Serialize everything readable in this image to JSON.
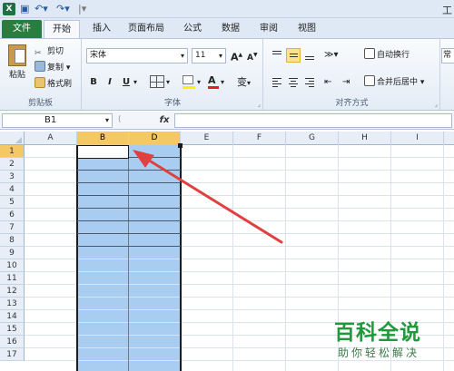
{
  "window": {
    "title": "工",
    "app_icon": "X"
  },
  "quick_access": {
    "save_icon": "save-icon",
    "undo_icon": "undo-icon",
    "redo_icon": "redo-icon"
  },
  "tabs": [
    {
      "label": "文件"
    },
    {
      "label": "开始"
    },
    {
      "label": "插入"
    },
    {
      "label": "页面布局"
    },
    {
      "label": "公式"
    },
    {
      "label": "数据"
    },
    {
      "label": "审阅"
    },
    {
      "label": "视图"
    }
  ],
  "ribbon": {
    "clipboard": {
      "label": "剪贴板",
      "paste": "粘贴",
      "cut": "剪切",
      "copy": "复制",
      "format_painter": "格式刷"
    },
    "font": {
      "label": "字体",
      "font_name": "宋体",
      "font_size": "11",
      "bold": "B",
      "italic": "I",
      "underline": "U",
      "phonetic": "变"
    },
    "alignment": {
      "label": "对齐方式",
      "wrap_text": "自动换行",
      "merge_center": "合并后居中"
    },
    "number": {
      "format": "常规"
    }
  },
  "formula_bar": {
    "name_box": "B1",
    "fx": "fx",
    "content": ""
  },
  "grid": {
    "columns": [
      "A",
      "B",
      "D",
      "E",
      "F",
      "G",
      "H",
      "I"
    ],
    "selected_columns": [
      "B",
      "D"
    ],
    "rows": [
      "1",
      "2",
      "3",
      "4",
      "5",
      "6",
      "7",
      "8",
      "9",
      "10",
      "11",
      "12",
      "13",
      "14",
      "15",
      "16",
      "17"
    ],
    "active_cell": "B1"
  },
  "watermark": {
    "title": "百科全说",
    "subtitle": "助你轻松解决"
  },
  "colors": {
    "selection": "#a9cdf0",
    "header_selected": "#f4c864",
    "file_tab": "#2a7d3f",
    "arrow": "#e04040"
  }
}
